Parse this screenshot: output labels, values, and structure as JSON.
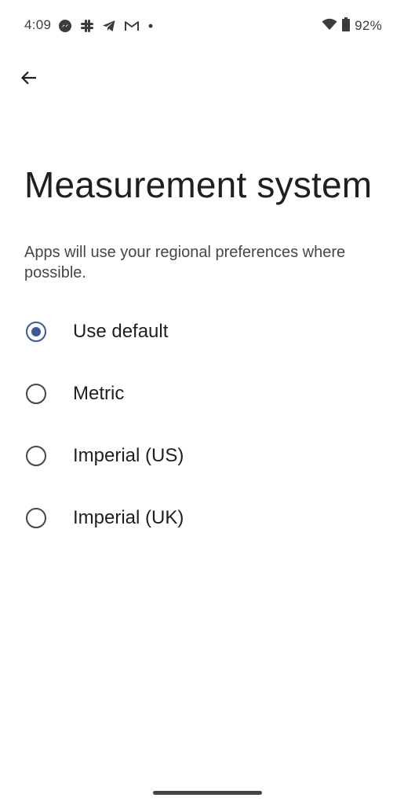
{
  "status_bar": {
    "time": "4:09",
    "notification_icons": [
      "messenger-icon",
      "slack-icon",
      "telegram-icon",
      "gmail-icon",
      "dot-icon"
    ],
    "wifi_icon": "wifi-icon",
    "battery_icon": "battery-icon",
    "battery_percent": "92%"
  },
  "toolbar": {
    "back_icon": "arrow-back-icon"
  },
  "page": {
    "title": "Measurement system",
    "description": "Apps will use your regional preferences where possible."
  },
  "options": [
    {
      "label": "Use default",
      "selected": true
    },
    {
      "label": "Metric",
      "selected": false
    },
    {
      "label": "Imperial (US)",
      "selected": false
    },
    {
      "label": "Imperial (UK)",
      "selected": false
    }
  ],
  "colors": {
    "accent": "#3a5a9a",
    "text_primary": "#1f1f1f",
    "text_secondary": "#444746"
  }
}
